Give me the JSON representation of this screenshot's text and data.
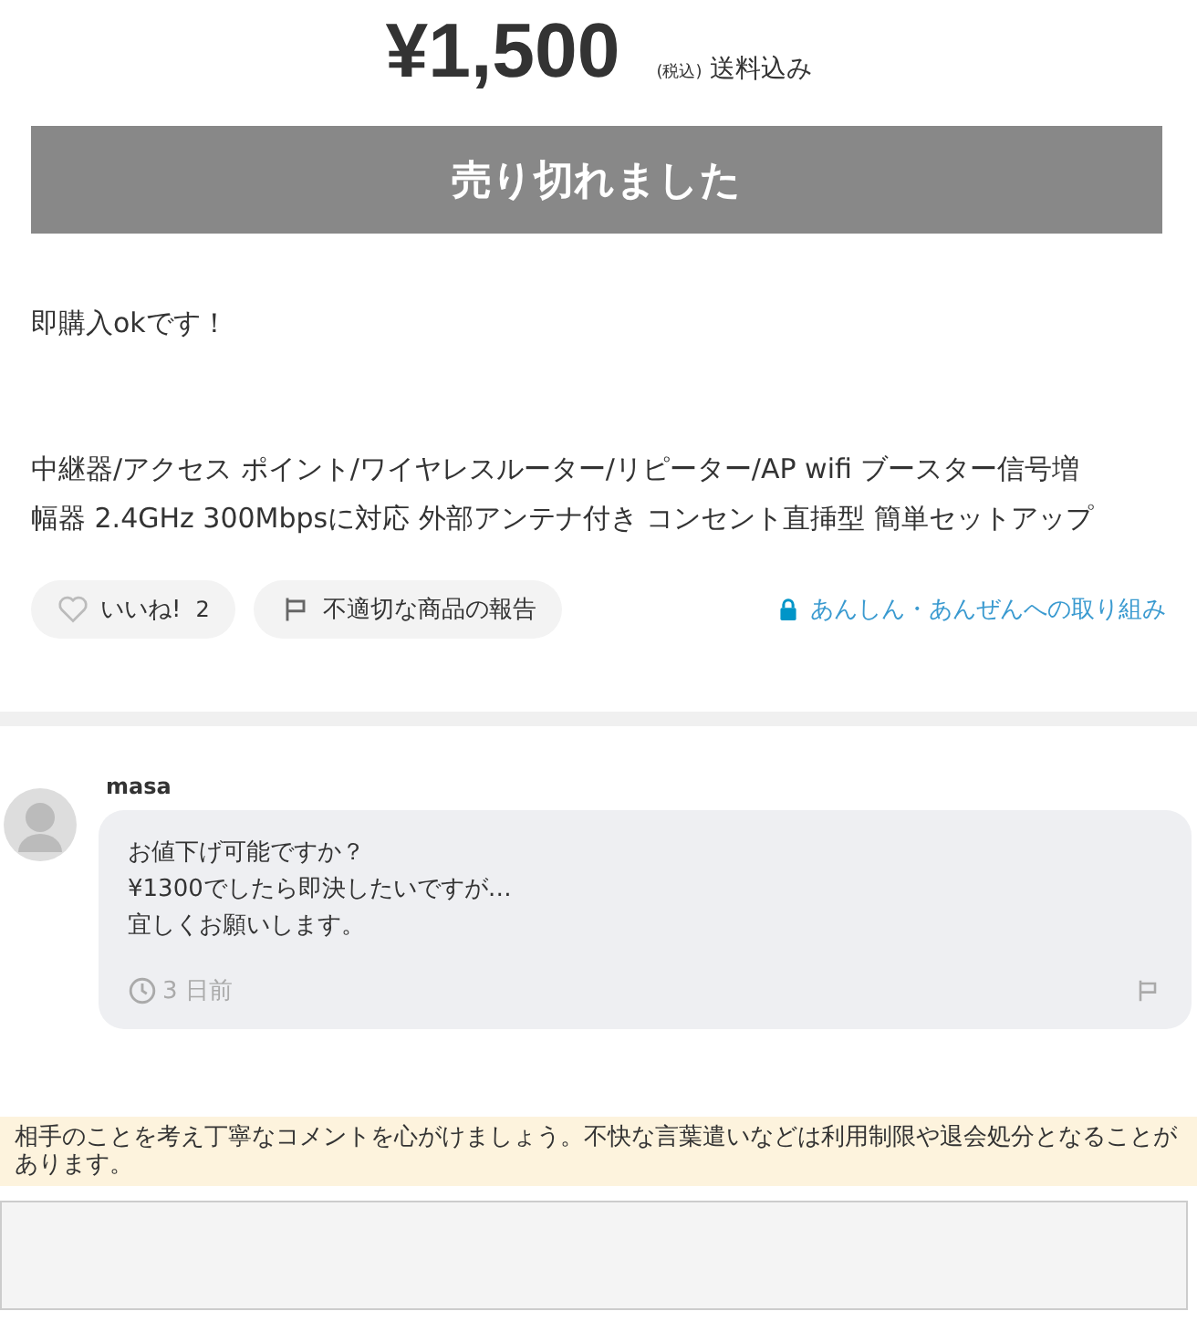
{
  "price": {
    "amount": "¥1,500",
    "tax": "(税込)",
    "shipping": "送料込み"
  },
  "status_button": {
    "label": "売り切れました",
    "disabled": true
  },
  "description": [
    "即購入okです！",
    "中継器/アクセス ポイント/ワイヤレスルーター/リピーター/AP wifi ブースター信号増幅器 2.4GHz 300Mbpsに対応 外部アンテナ付き コンセント直挿型 簡単セットアップ"
  ],
  "actions": {
    "like": {
      "label": "いいね!",
      "count": "2",
      "liked": false
    },
    "report": {
      "label": "不適切な商品の報告"
    },
    "safety_link": "あんしん・あんぜんへの取り組み"
  },
  "comments": [
    {
      "user": "masa",
      "lines": [
        "お値下げ可能ですか？",
        "¥1300でしたら即決したいですが…",
        "宜しくお願いします。"
      ],
      "time": "3 日前"
    }
  ],
  "notice": "相手のことを考え丁寧なコメントを心がけましょう。不快な言葉遣いなどは利用制限や退会処分となることがあります。"
}
